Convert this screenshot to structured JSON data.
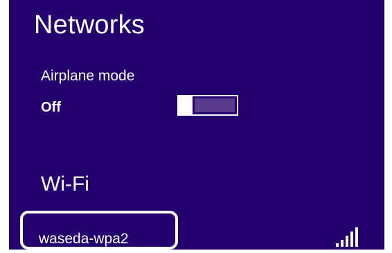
{
  "panel": {
    "title": "Networks",
    "background_color": "#23006e"
  },
  "airplane_mode": {
    "label": "Airplane mode",
    "state": "Off",
    "toggle_on": false
  },
  "wifi": {
    "heading": "Wi-Fi",
    "networks": [
      {
        "name": "waseda-wpa2",
        "signal_icon": "signal-strength-icon",
        "signal_level": 5,
        "signal_max": 5,
        "selected": true
      }
    ]
  }
}
